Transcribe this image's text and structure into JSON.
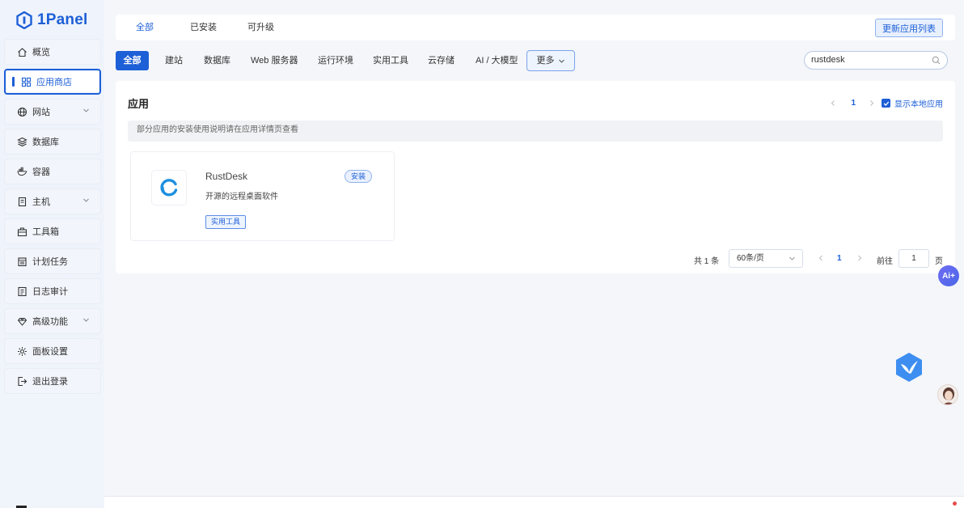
{
  "sidebar": {
    "brand": "1Panel",
    "items": [
      {
        "label": "概览",
        "icon": "home-icon"
      },
      {
        "label": "应用商店",
        "icon": "apps-grid-icon",
        "active": true
      },
      {
        "label": "网站",
        "icon": "globe-icon",
        "expandable": true
      },
      {
        "label": "数据库",
        "icon": "database-layers-icon"
      },
      {
        "label": "容器",
        "icon": "docker-icon"
      },
      {
        "label": "主机",
        "icon": "host-icon",
        "expandable": true
      },
      {
        "label": "工具箱",
        "icon": "toolbox-icon"
      },
      {
        "label": "计划任务",
        "icon": "calendar-icon"
      },
      {
        "label": "日志审计",
        "icon": "log-icon"
      },
      {
        "label": "高级功能",
        "icon": "diamond-icon",
        "expandable": true
      },
      {
        "label": "面板设置",
        "icon": "settings-icon"
      },
      {
        "label": "退出登录",
        "icon": "logout-icon"
      }
    ]
  },
  "top_tabs": {
    "all": "全部",
    "installed": "已安装",
    "upgradable": "可升级",
    "update_button": "更新应用列表"
  },
  "categories": {
    "all": "全部",
    "website": "建站",
    "database": "数据库",
    "web_server": "Web 服务器",
    "runtime": "运行环境",
    "tools": "实用工具",
    "storage": "云存储",
    "ai": "AI / 大模型",
    "more": "更多"
  },
  "search": {
    "value": "rustdesk"
  },
  "main": {
    "title": "应用",
    "page": "1",
    "show_local_label": "显示本地应用",
    "show_local_checked": true,
    "notice": "部分应用的安装使用说明请在应用详情页查看"
  },
  "app": {
    "name": "RustDesk",
    "description": "开源的远程桌面软件",
    "tag": "实用工具",
    "install_label": "安装"
  },
  "pagination": {
    "total": "共 1 条",
    "page_size": "60条/页",
    "current": "1",
    "goto_label": "前往",
    "goto_value": "1",
    "unit": "页"
  },
  "widgets": {
    "ai_label": "Ai+"
  },
  "colors": {
    "accent": "#1d5fd6",
    "background": "#f4f6fa",
    "card": "#ffffff"
  }
}
